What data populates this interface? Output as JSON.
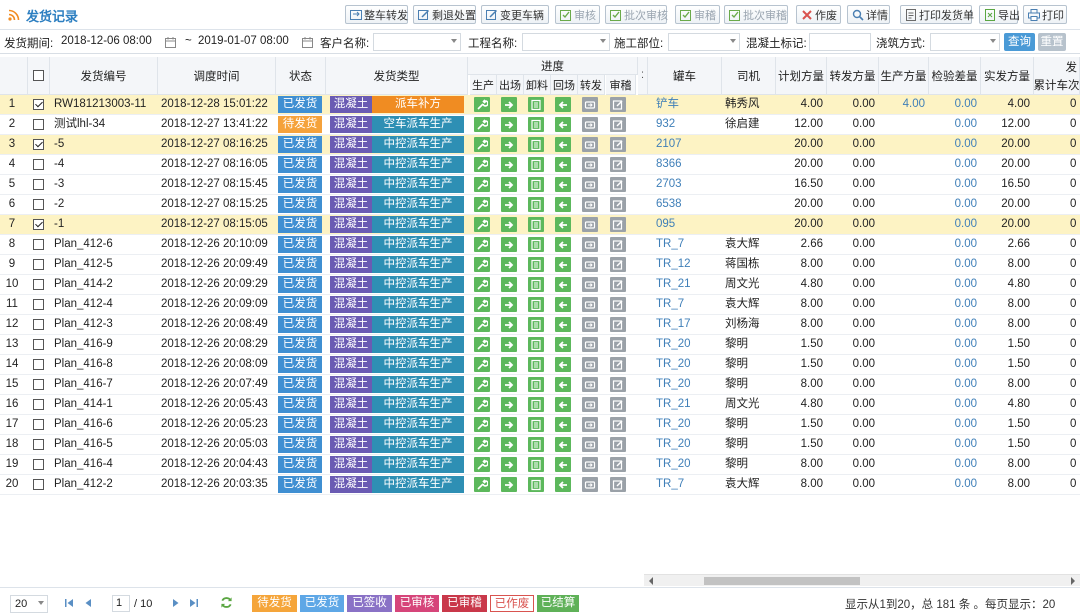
{
  "title": "发货记录",
  "toolbar": [
    {
      "label": "整车转发",
      "icon": "transfer-icon",
      "enabled": true
    },
    {
      "label": "剩退处置",
      "icon": "edit-icon",
      "enabled": true
    },
    {
      "label": "变更车辆",
      "icon": "edit-icon",
      "enabled": true
    },
    {
      "label": "审核",
      "icon": "check-icon",
      "enabled": false
    },
    {
      "label": "批次审核",
      "icon": "check-icon",
      "enabled": false
    },
    {
      "label": "审稽",
      "icon": "check-icon",
      "enabled": false
    },
    {
      "label": "批次审稽",
      "icon": "check-icon",
      "enabled": false
    },
    {
      "label": "作废",
      "icon": "close-icon",
      "enabled": true
    },
    {
      "label": "详情",
      "icon": "search-icon",
      "enabled": true
    },
    {
      "label": "打印发货单",
      "icon": "document-icon",
      "enabled": true
    },
    {
      "label": "导出",
      "icon": "export-icon",
      "enabled": true
    },
    {
      "label": "打印",
      "icon": "print-icon",
      "enabled": true
    }
  ],
  "filters": {
    "period_label": "发货期间:",
    "date_from": "2018-12-06 08:00",
    "date_sep": "~",
    "date_to": "2019-01-07 08:00",
    "customer_label": "客户名称:",
    "project_label": "工程名称:",
    "site_label": "施工部位:",
    "concrete_label": "混凝土标记:",
    "pour_label": "浇筑方式:",
    "query_button": "查询",
    "reset_button": "重置"
  },
  "columns": {
    "no": "发货编号",
    "time": "调度时间",
    "status": "状态",
    "type": "发货类型",
    "progress": "进度",
    "progress_steps": [
      "生产",
      "出场",
      "卸料",
      "回场",
      "转发",
      "审稽"
    ],
    "truck": "罐车",
    "driver": "司机",
    "plan": "计划方量",
    "forward": "转发方量",
    "produce": "生产方量",
    "check": "检验差量",
    "actual": "实发方量",
    "cum_top": "发",
    "cum": "累计车次"
  },
  "rows": [
    {
      "idx": "1",
      "checked": true,
      "no": "RW181213003-11",
      "time": "2018-12-28 15:01:22",
      "status": "已发货",
      "kind": "混凝土",
      "type": "派车补方",
      "type_color": "orange",
      "truck": "铲车",
      "driver": "韩秀风",
      "plan": "4.00",
      "forward": "0.00",
      "produce": "4.00",
      "check": "0.00",
      "actual": "4.00",
      "cum": "0"
    },
    {
      "idx": "2",
      "checked": false,
      "no": "测试lhl-34",
      "time": "2018-12-27 13:41:22",
      "status": "待发货",
      "kind": "混凝土",
      "type": "空车派车生产",
      "type_color": "teal",
      "truck": "932",
      "driver": "徐启建",
      "plan": "12.00",
      "forward": "0.00",
      "produce": "",
      "check": "0.00",
      "actual": "12.00",
      "cum": "0"
    },
    {
      "idx": "3",
      "checked": true,
      "no": "-5",
      "time": "2018-12-27 08:16:25",
      "status": "已发货",
      "kind": "混凝土",
      "type": "中控派车生产",
      "type_color": "teal",
      "truck": "2107",
      "driver": "",
      "plan": "20.00",
      "forward": "0.00",
      "produce": "",
      "check": "0.00",
      "actual": "20.00",
      "cum": "0"
    },
    {
      "idx": "4",
      "checked": false,
      "no": "-4",
      "time": "2018-12-27 08:16:05",
      "status": "已发货",
      "kind": "混凝土",
      "type": "中控派车生产",
      "type_color": "teal",
      "truck": "8366",
      "driver": "",
      "plan": "20.00",
      "forward": "0.00",
      "produce": "",
      "check": "0.00",
      "actual": "20.00",
      "cum": "0"
    },
    {
      "idx": "5",
      "checked": false,
      "no": "-3",
      "time": "2018-12-27 08:15:45",
      "status": "已发货",
      "kind": "混凝土",
      "type": "中控派车生产",
      "type_color": "teal",
      "truck": "2703",
      "driver": "",
      "plan": "16.50",
      "forward": "0.00",
      "produce": "",
      "check": "0.00",
      "actual": "16.50",
      "cum": "0"
    },
    {
      "idx": "6",
      "checked": false,
      "no": "-2",
      "time": "2018-12-27 08:15:25",
      "status": "已发货",
      "kind": "混凝土",
      "type": "中控派车生产",
      "type_color": "teal",
      "truck": "6538",
      "driver": "",
      "plan": "20.00",
      "forward": "0.00",
      "produce": "",
      "check": "0.00",
      "actual": "20.00",
      "cum": "0"
    },
    {
      "idx": "7",
      "checked": true,
      "no": "-1",
      "time": "2018-12-27 08:15:05",
      "status": "已发货",
      "kind": "混凝土",
      "type": "中控派车生产",
      "type_color": "teal",
      "truck": "095",
      "driver": "",
      "plan": "20.00",
      "forward": "0.00",
      "produce": "",
      "check": "0.00",
      "actual": "20.00",
      "cum": "0"
    },
    {
      "idx": "8",
      "checked": false,
      "no": "Plan_412-6",
      "time": "2018-12-26 20:10:09",
      "status": "已发货",
      "kind": "混凝土",
      "type": "中控派车生产",
      "type_color": "teal",
      "truck": "TR_7",
      "driver": "袁大辉",
      "plan": "2.66",
      "forward": "0.00",
      "produce": "",
      "check": "0.00",
      "actual": "2.66",
      "cum": "0"
    },
    {
      "idx": "9",
      "checked": false,
      "no": "Plan_412-5",
      "time": "2018-12-26 20:09:49",
      "status": "已发货",
      "kind": "混凝土",
      "type": "中控派车生产",
      "type_color": "teal",
      "truck": "TR_12",
      "driver": "蒋国栋",
      "plan": "8.00",
      "forward": "0.00",
      "produce": "",
      "check": "0.00",
      "actual": "8.00",
      "cum": "0"
    },
    {
      "idx": "10",
      "checked": false,
      "no": "Plan_414-2",
      "time": "2018-12-26 20:09:29",
      "status": "已发货",
      "kind": "混凝土",
      "type": "中控派车生产",
      "type_color": "teal",
      "truck": "TR_21",
      "driver": "周文光",
      "plan": "4.80",
      "forward": "0.00",
      "produce": "",
      "check": "0.00",
      "actual": "4.80",
      "cum": "0"
    },
    {
      "idx": "11",
      "checked": false,
      "no": "Plan_412-4",
      "time": "2018-12-26 20:09:09",
      "status": "已发货",
      "kind": "混凝土",
      "type": "中控派车生产",
      "type_color": "teal",
      "truck": "TR_7",
      "driver": "袁大辉",
      "plan": "8.00",
      "forward": "0.00",
      "produce": "",
      "check": "0.00",
      "actual": "8.00",
      "cum": "0"
    },
    {
      "idx": "12",
      "checked": false,
      "no": "Plan_412-3",
      "time": "2018-12-26 20:08:49",
      "status": "已发货",
      "kind": "混凝土",
      "type": "中控派车生产",
      "type_color": "teal",
      "truck": "TR_17",
      "driver": "刘杨海",
      "plan": "8.00",
      "forward": "0.00",
      "produce": "",
      "check": "0.00",
      "actual": "8.00",
      "cum": "0"
    },
    {
      "idx": "13",
      "checked": false,
      "no": "Plan_416-9",
      "time": "2018-12-26 20:08:29",
      "status": "已发货",
      "kind": "混凝土",
      "type": "中控派车生产",
      "type_color": "teal",
      "truck": "TR_20",
      "driver": "黎明",
      "plan": "1.50",
      "forward": "0.00",
      "produce": "",
      "check": "0.00",
      "actual": "1.50",
      "cum": "0"
    },
    {
      "idx": "14",
      "checked": false,
      "no": "Plan_416-8",
      "time": "2018-12-26 20:08:09",
      "status": "已发货",
      "kind": "混凝土",
      "type": "中控派车生产",
      "type_color": "teal",
      "truck": "TR_20",
      "driver": "黎明",
      "plan": "1.50",
      "forward": "0.00",
      "produce": "",
      "check": "0.00",
      "actual": "1.50",
      "cum": "0"
    },
    {
      "idx": "15",
      "checked": false,
      "no": "Plan_416-7",
      "time": "2018-12-26 20:07:49",
      "status": "已发货",
      "kind": "混凝土",
      "type": "中控派车生产",
      "type_color": "teal",
      "truck": "TR_20",
      "driver": "黎明",
      "plan": "8.00",
      "forward": "0.00",
      "produce": "",
      "check": "0.00",
      "actual": "8.00",
      "cum": "0"
    },
    {
      "idx": "16",
      "checked": false,
      "no": "Plan_414-1",
      "time": "2018-12-26 20:05:43",
      "status": "已发货",
      "kind": "混凝土",
      "type": "中控派车生产",
      "type_color": "teal",
      "truck": "TR_21",
      "driver": "周文光",
      "plan": "4.80",
      "forward": "0.00",
      "produce": "",
      "check": "0.00",
      "actual": "4.80",
      "cum": "0"
    },
    {
      "idx": "17",
      "checked": false,
      "no": "Plan_416-6",
      "time": "2018-12-26 20:05:23",
      "status": "已发货",
      "kind": "混凝土",
      "type": "中控派车生产",
      "type_color": "teal",
      "truck": "TR_20",
      "driver": "黎明",
      "plan": "1.50",
      "forward": "0.00",
      "produce": "",
      "check": "0.00",
      "actual": "1.50",
      "cum": "0"
    },
    {
      "idx": "18",
      "checked": false,
      "no": "Plan_416-5",
      "time": "2018-12-26 20:05:03",
      "status": "已发货",
      "kind": "混凝土",
      "type": "中控派车生产",
      "type_color": "teal",
      "truck": "TR_20",
      "driver": "黎明",
      "plan": "1.50",
      "forward": "0.00",
      "produce": "",
      "check": "0.00",
      "actual": "1.50",
      "cum": "0"
    },
    {
      "idx": "19",
      "checked": false,
      "no": "Plan_416-4",
      "time": "2018-12-26 20:04:43",
      "status": "已发货",
      "kind": "混凝土",
      "type": "中控派车生产",
      "type_color": "teal",
      "truck": "TR_20",
      "driver": "黎明",
      "plan": "8.00",
      "forward": "0.00",
      "produce": "",
      "check": "0.00",
      "actual": "8.00",
      "cum": "0"
    },
    {
      "idx": "20",
      "checked": false,
      "no": "Plan_412-2",
      "time": "2018-12-26 20:03:35",
      "status": "已发货",
      "kind": "混凝土",
      "type": "中控派车生产",
      "type_color": "teal",
      "truck": "TR_7",
      "driver": "袁大辉",
      "plan": "8.00",
      "forward": "0.00",
      "produce": "",
      "check": "0.00",
      "actual": "8.00",
      "cum": "0"
    }
  ],
  "progress_icons": [
    "wrench-icon",
    "arrow-right-icon",
    "unload-icon",
    "arrow-left-icon",
    "forward-icon",
    "audit-icon"
  ],
  "footer": {
    "page_size": "20",
    "page": "1",
    "page_total": "/ 10",
    "legend": [
      {
        "label": "待发货",
        "color": "#f5a53a"
      },
      {
        "label": "已发货",
        "color": "#5ea7e6"
      },
      {
        "label": "已签收",
        "color": "#8a72c6"
      },
      {
        "label": "已审核",
        "color": "#d6457a"
      },
      {
        "label": "已审稽",
        "color": "#c9384a"
      },
      {
        "label": "已作废",
        "color": "#ffffff"
      },
      {
        "label": "已结算",
        "color": "#5fb158"
      }
    ],
    "summary": "显示从1到20，总 181 条 。每页显示：20"
  },
  "colors": {
    "status_done": "#3f8fd2",
    "status_pending": "#f5a23b",
    "kind": "#6a5bb3",
    "type_teal": "#2e8fb4",
    "type_orange": "#f08c22",
    "progress_green": "#5cb85c",
    "progress_gray": "#9aa1a8",
    "selected_row": "#fdf3c4"
  }
}
